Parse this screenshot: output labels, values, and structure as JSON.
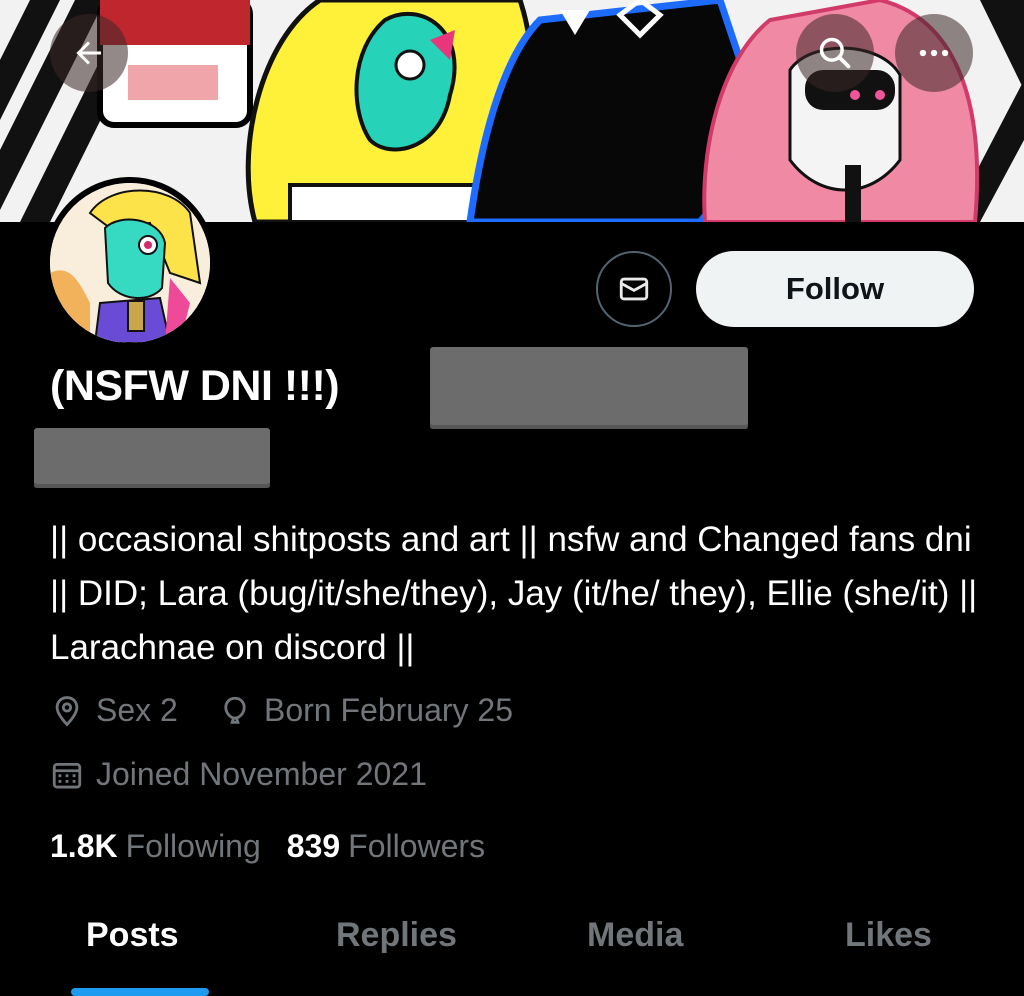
{
  "header": {
    "back_icon": "arrow-left-icon",
    "search_icon": "search-icon",
    "more_icon": "more-horizontal-icon"
  },
  "profile": {
    "display_name": "(NSFW DNI !!!)",
    "bio": "|| occasional shitposts and art || nsfw and Changed fans dni || DID; Lara (bug/it/she/they), Jay (it/he/ they), Ellie (she/it) || Larachnae on discord ||",
    "location": "Sex 2",
    "birthday": "Born February 25",
    "joined": "Joined November 2021",
    "following_count": "1.8K",
    "following_label": "Following",
    "followers_count": "839",
    "followers_label": "Followers"
  },
  "actions": {
    "message_icon": "envelope-icon",
    "follow_label": "Follow"
  },
  "tabs": [
    {
      "label": "Posts",
      "active": true
    },
    {
      "label": "Replies",
      "active": false
    },
    {
      "label": "Media",
      "active": false
    },
    {
      "label": "Likes",
      "active": false
    }
  ],
  "colors": {
    "accent": "#1d9bf0",
    "text_primary": "#e7e9ea",
    "text_secondary": "#71767b",
    "background": "#000000"
  }
}
